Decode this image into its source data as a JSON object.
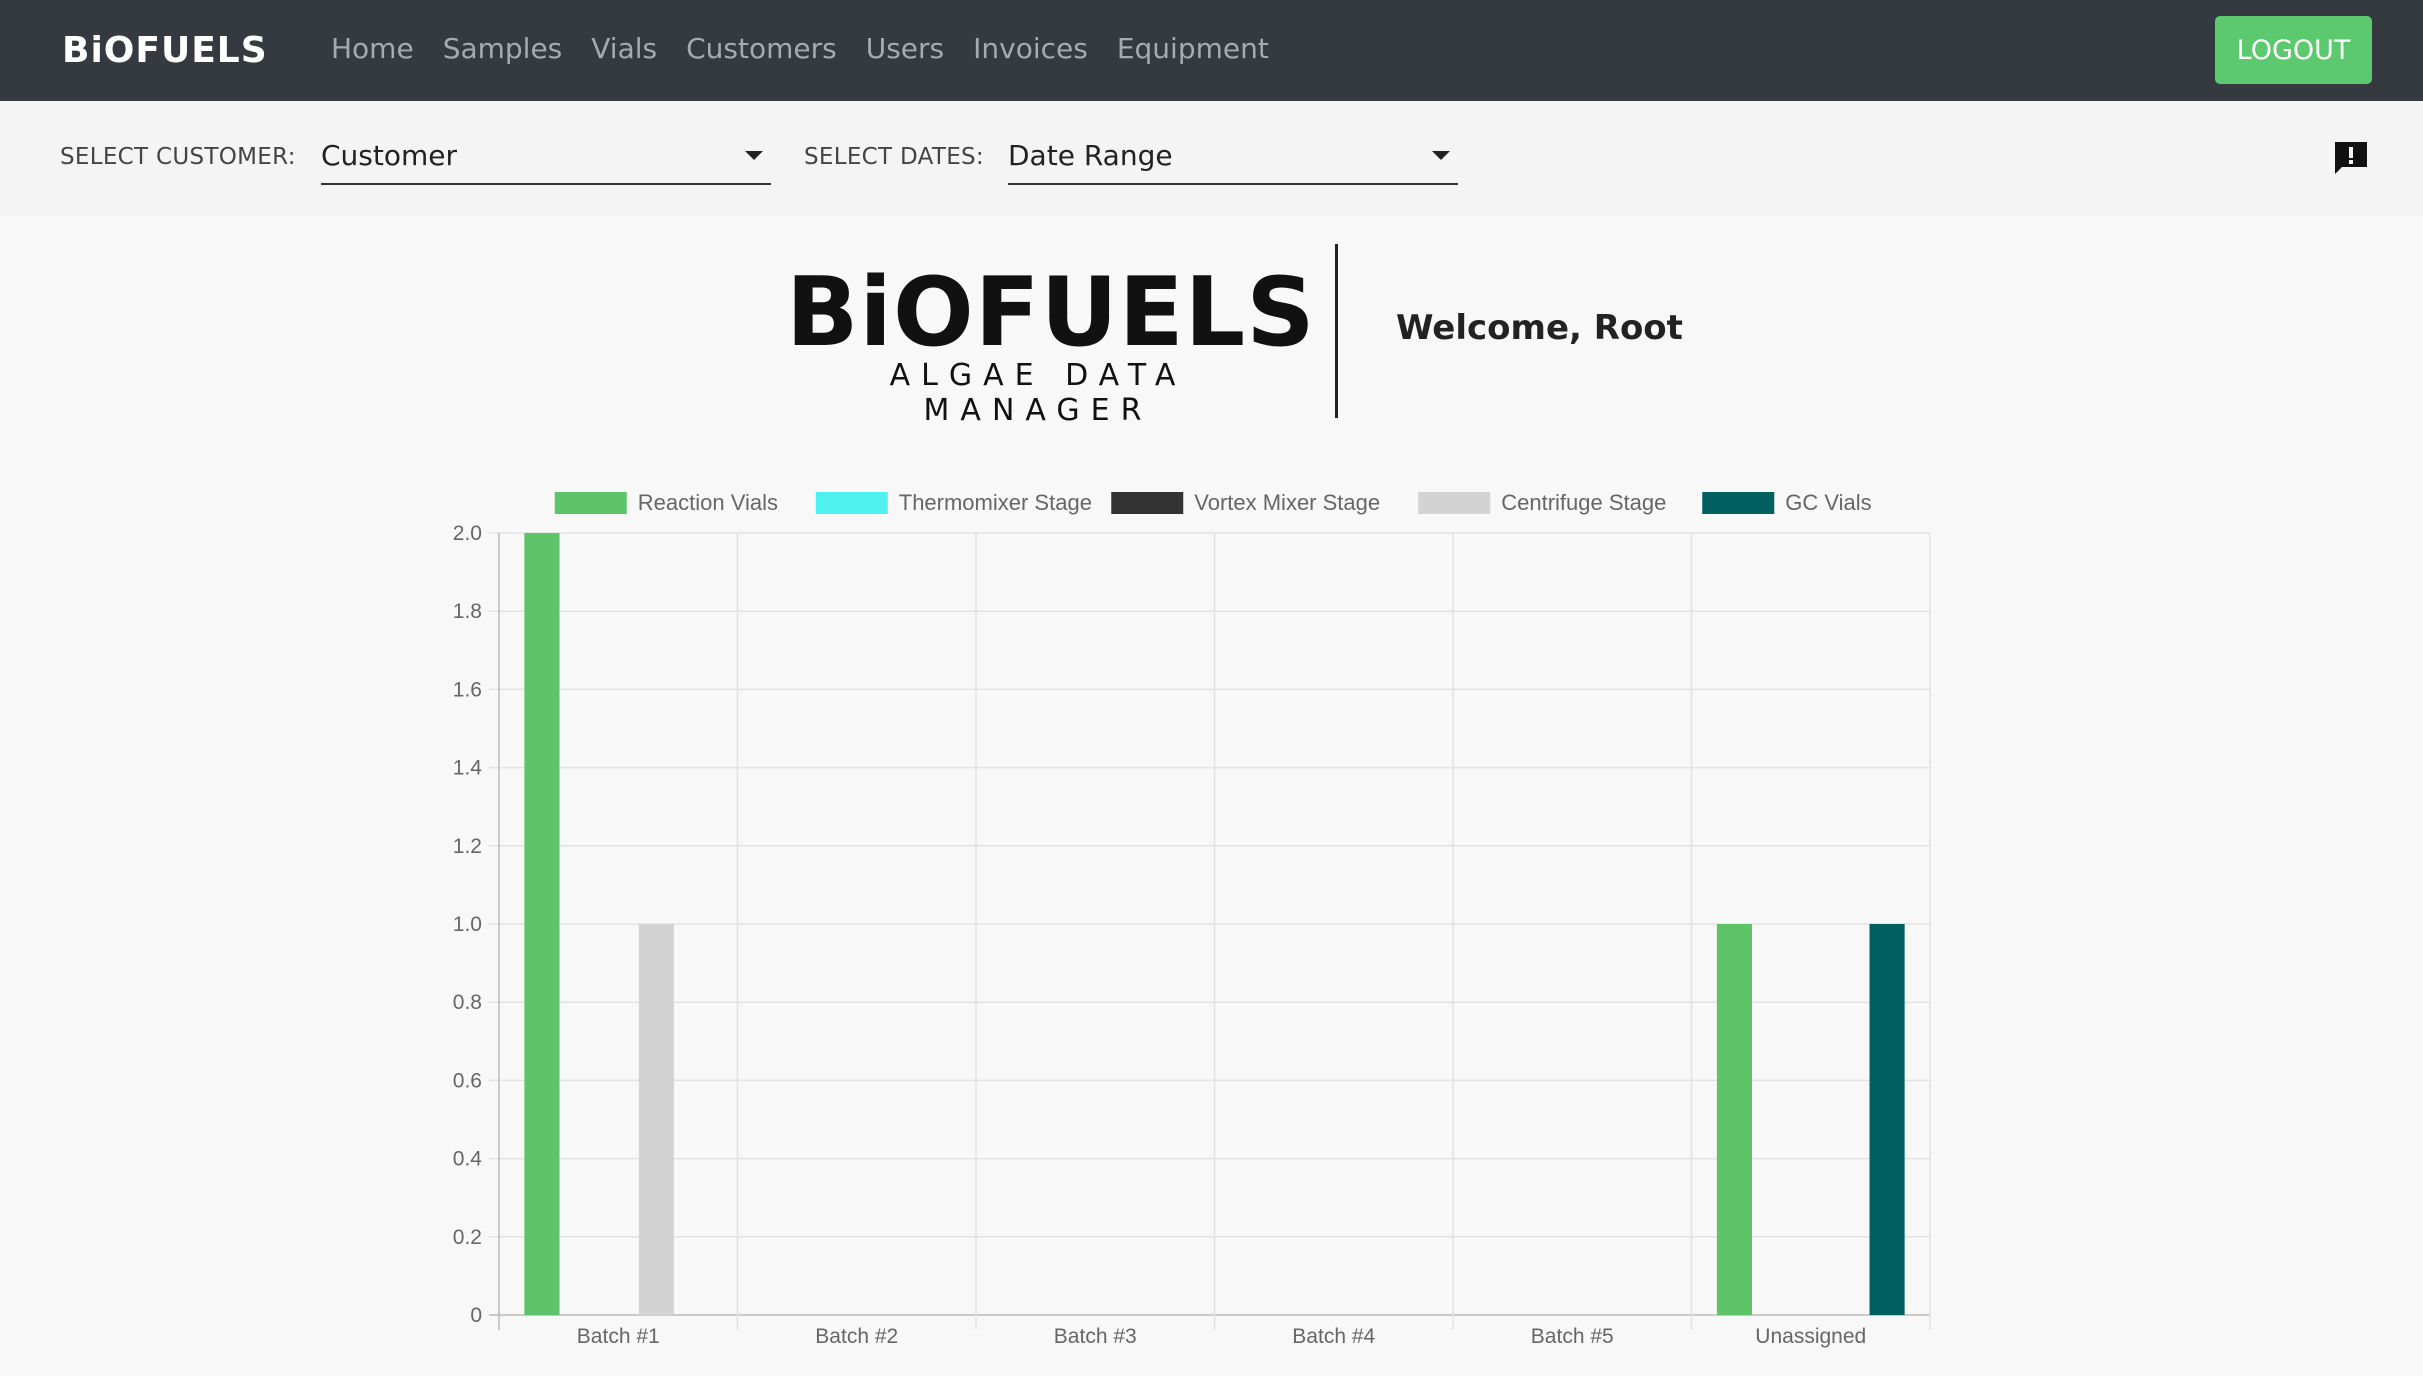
{
  "nav": {
    "brand": "BiOFUELS",
    "links": [
      "Home",
      "Samples",
      "Vials",
      "Customers",
      "Users",
      "Invoices",
      "Equipment"
    ],
    "logout_label": "LOGOUT"
  },
  "filters": {
    "customer_label": "SELECT CUSTOMER:",
    "customer_value": "Customer",
    "dates_label": "SELECT DATES:",
    "dates_value": "Date Range"
  },
  "header": {
    "logo_title": "BiOFUELS",
    "logo_subtitle": "ALGAE DATA MANAGER",
    "welcome": "Welcome, Root"
  },
  "colors": {
    "navbar": "#343a40",
    "logout": "#5cc96e"
  },
  "chart_data": {
    "type": "bar",
    "categories": [
      "Batch #1",
      "Batch #2",
      "Batch #3",
      "Batch #4",
      "Batch #5",
      "Unassigned"
    ],
    "series": [
      {
        "name": "Reaction Vials",
        "color": "#5ec46a",
        "values": [
          2,
          0,
          0,
          0,
          0,
          1
        ]
      },
      {
        "name": "Thermomixer Stage",
        "color": "#4ff0f0",
        "values": [
          0,
          0,
          0,
          0,
          0,
          0
        ]
      },
      {
        "name": "Vortex Mixer Stage",
        "color": "#333333",
        "values": [
          0,
          0,
          0,
          0,
          0,
          0
        ]
      },
      {
        "name": "Centrifuge Stage",
        "color": "#d3d3d3",
        "values": [
          1,
          0,
          0,
          0,
          0,
          0
        ]
      },
      {
        "name": "GC Vials",
        "color": "#005f5f",
        "values": [
          0,
          0,
          0,
          0,
          0,
          1
        ]
      }
    ],
    "ylim": [
      0,
      2.0
    ],
    "yticks": [
      "0",
      "0.2",
      "0.4",
      "0.6",
      "0.8",
      "1.0",
      "1.2",
      "1.4",
      "1.6",
      "1.8",
      "2.0"
    ],
    "grid": true,
    "legend_position": "top"
  }
}
